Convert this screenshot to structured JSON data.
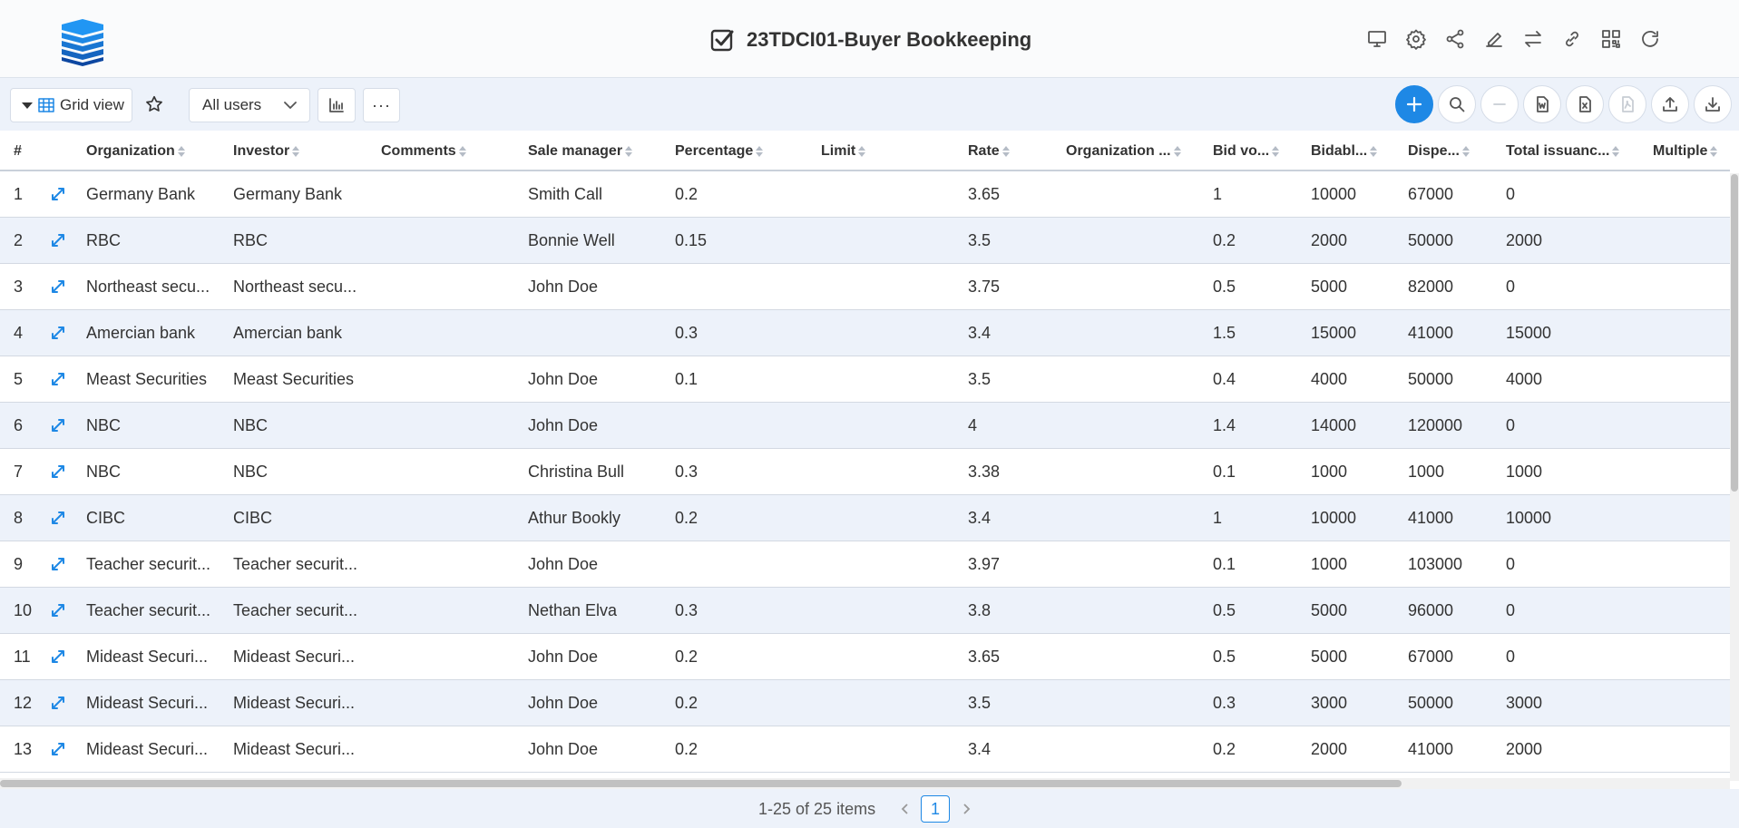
{
  "header": {
    "title": "23TDCI01-Buyer Bookkeeping"
  },
  "toolbar": {
    "view_label": "Grid view",
    "user_filter": "All users",
    "more_label": "···"
  },
  "columns": [
    "#",
    "Organization",
    "Investor",
    "Comments",
    "Sale manager",
    "Percentage",
    "Limit",
    "Rate",
    "Organization ...",
    "Bid vo...",
    "Bidabl...",
    "Dispe...",
    "Total issuanc...",
    "Multiple"
  ],
  "rows": [
    [
      "1",
      "Germany Bank",
      "Germany Bank",
      "",
      "Smith Call",
      "0.2",
      "",
      "3.65",
      "",
      "1",
      "10000",
      "67000",
      "0",
      ""
    ],
    [
      "2",
      "RBC",
      "RBC",
      "",
      "Bonnie Well",
      "0.15",
      "",
      "3.5",
      "",
      "0.2",
      "2000",
      "50000",
      "2000",
      ""
    ],
    [
      "3",
      "Northeast secu...",
      "Northeast secu...",
      "",
      "John Doe",
      "",
      "",
      "3.75",
      "",
      "0.5",
      "5000",
      "82000",
      "0",
      ""
    ],
    [
      "4",
      "Amercian bank",
      "Amercian bank",
      "",
      "",
      "0.3",
      "",
      "3.4",
      "",
      "1.5",
      "15000",
      "41000",
      "15000",
      ""
    ],
    [
      "5",
      "Meast Securities",
      "Meast Securities",
      "",
      "John Doe",
      "0.1",
      "",
      "3.5",
      "",
      "0.4",
      "4000",
      "50000",
      "4000",
      ""
    ],
    [
      "6",
      "NBC",
      "NBC",
      "",
      "John Doe",
      "",
      "",
      "4",
      "",
      "1.4",
      "14000",
      "120000",
      "0",
      ""
    ],
    [
      "7",
      "NBC",
      "NBC",
      "",
      "Christina Bull",
      "0.3",
      "",
      "3.38",
      "",
      "0.1",
      "1000",
      "1000",
      "1000",
      ""
    ],
    [
      "8",
      "CIBC",
      "CIBC",
      "",
      "Athur Bookly",
      "0.2",
      "",
      "3.4",
      "",
      "1",
      "10000",
      "41000",
      "10000",
      ""
    ],
    [
      "9",
      "Teacher securit...",
      "Teacher securit...",
      "",
      "John Doe",
      "",
      "",
      "3.97",
      "",
      "0.1",
      "1000",
      "103000",
      "0",
      ""
    ],
    [
      "10",
      "Teacher securit...",
      "Teacher securit...",
      "",
      "Nethan Elva",
      "0.3",
      "",
      "3.8",
      "",
      "0.5",
      "5000",
      "96000",
      "0",
      ""
    ],
    [
      "11",
      "Mideast Securi...",
      "Mideast Securi...",
      "",
      "John Doe",
      "0.2",
      "",
      "3.65",
      "",
      "0.5",
      "5000",
      "67000",
      "0",
      ""
    ],
    [
      "12",
      "Mideast Securi...",
      "Mideast Securi...",
      "",
      "John Doe",
      "0.2",
      "",
      "3.5",
      "",
      "0.3",
      "3000",
      "50000",
      "3000",
      ""
    ],
    [
      "13",
      "Mideast Securi...",
      "Mideast Securi...",
      "",
      "John Doe",
      "0.2",
      "",
      "3.4",
      "",
      "0.2",
      "2000",
      "41000",
      "2000",
      ""
    ]
  ],
  "pagination": {
    "info": "1-25 of 25 items",
    "current": "1"
  },
  "colors": {
    "accent": "#1e88e5",
    "row_alt": "#edf2fa",
    "toolbar_bg": "#edf2fa"
  }
}
